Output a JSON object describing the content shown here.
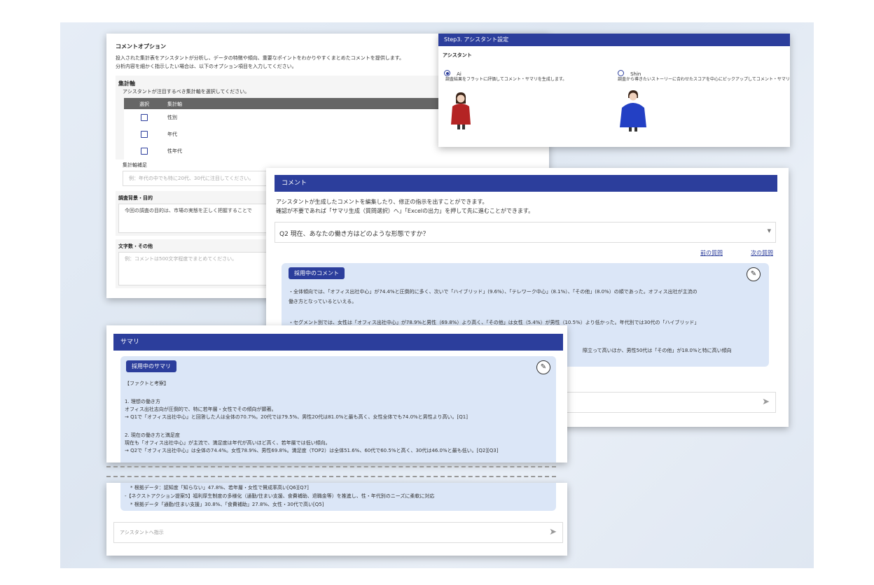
{
  "options": {
    "title": "コメントオプション",
    "desc1": "投入された集計表をアシスタントが分析し、データの特徴や傾向、重要なポイントをわかりやすくまとめたコメントを提供します。",
    "desc2": "分析内容を細かく指示したい場合は、以下のオプション項目を入力してください。",
    "axis_title": "集計軸",
    "axis_desc": "アシスタントが注目するべき集計軸を選択してください。",
    "col_select": "選択",
    "col_axis": "集計軸",
    "rows": [
      "性別",
      "年代",
      "性年代"
    ],
    "supplement_label": "集計軸補足",
    "supplement_placeholder": "例：年代の中でも特に20代、30代に注目してください。",
    "background_label": "調査背景・目的",
    "background_value": "今回の調査の目的は、市場の実態を正しく把握することで",
    "chars_label": "文字数・その他",
    "chars_placeholder": "例：コメントは500文字程度でまとめてください。"
  },
  "assistant": {
    "header": "Step3. アシスタント設定",
    "label": "アシスタント",
    "options": [
      {
        "name": "Ai",
        "desc": "調査結果をフラットに評価してコメント・サマリを生成します。",
        "selected": true
      },
      {
        "name": "Shin",
        "desc": "調査から導きたいストーリーに合わせたスコアを中心にピックアップしてコメント・サマリを生成します。",
        "selected": false
      }
    ]
  },
  "comment": {
    "header": "コメント",
    "desc1": "アシスタントが生成したコメントを編集したり、修正の指示を出すことができます。",
    "desc2": "確認が不要であれば「サマリ生成（質問選択）へ」「Excelの出力」を押して先に進むことができます。",
    "question_select": "Q2 現在、あなたの働き方はどのような形態ですか？",
    "prev_link": "前の質問",
    "next_link": "次の質問",
    "adopted_label": "採用中のコメント",
    "text1": "・全体傾向では、「オフィス出社中心」が74.4%と圧倒的に多く、次いで「ハイブリッド」(9.6%）、「テレワーク中心」(8.1%）、「その他」(8.0%）の順であった。オフィス出社が主流の",
    "text2": "働き方となっているといえる。",
    "text3": "・セグメント別では、女性は「オフィス出社中心」が78.9%と男性（69.8%）より高く、「その他」は女性（5.4%）が男性（10.5%）より低かった。年代別では30代の「ハイブリッド」",
    "text4": "際立って高いほか、男性50代は「その他」が18.0%と特に高い傾向"
  },
  "summary": {
    "header": "サマリ",
    "adopted_label": "採用中のサマリ",
    "heading": "【ファクトと考察】",
    "s1_title": "1. 理想の働き方",
    "s1_line1": "オフィス出社志向が圧倒的で、特に若年層・女性でその傾向が顕著。",
    "s1_line2": "→ Q1で「オフィス出社中心」と回答した人は全体の70.7%。20代では79.5%、男性20代は81.0%と最も高く、女性全体でも74.0%と男性より高い。[Q1]",
    "s2_title": "2. 現在の働き方と満足度",
    "s2_line1": "現在も「オフィス出社中心」が主流で、満足度は年代が高いほど高く、若年層では低い傾向。",
    "s2_line2": "→ Q2で「オフィス出社中心」は全体の74.4%。女性78.9%、男性69.8%。満足度（TOP2）は全体51.6%、60代で60.5%と高く、30代は46.0%と最も低い。[Q2][Q3]",
    "tail1": "* 根拠データ：認知度「知らない」47.8%、若年層・女性で賛成率高い[Q6][Q7]",
    "tail2": "-【ネクストアクション提案5】福利厚生制度の多様化（通勤/住まい支援、食費補助、退職金等）を推進し、性・年代別のニーズに柔軟に対応",
    "tail3": "* 根拠データ「通勤/住まい支援」30.8%、「食費補助」27.8%、女性・30代で高い[Q5]",
    "input_placeholder": "アシスタントへ指示"
  },
  "icons": {
    "edit": "pencil-icon",
    "send": "send-icon",
    "dropdown": "chevron-down-icon"
  },
  "colors": {
    "accent": "#2c3e9c",
    "bubble": "#dbe6f7"
  }
}
